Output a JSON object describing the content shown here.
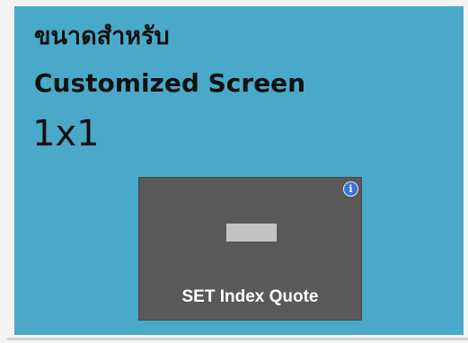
{
  "card": {
    "title_thai": "ขนาดสำหรับ",
    "title_en": "Customized Screen",
    "size": "1x1",
    "background_color": "#4aa9c8"
  },
  "widget": {
    "label": "SET Index Quote",
    "info_icon": "info-icon",
    "info_glyph": "i"
  }
}
